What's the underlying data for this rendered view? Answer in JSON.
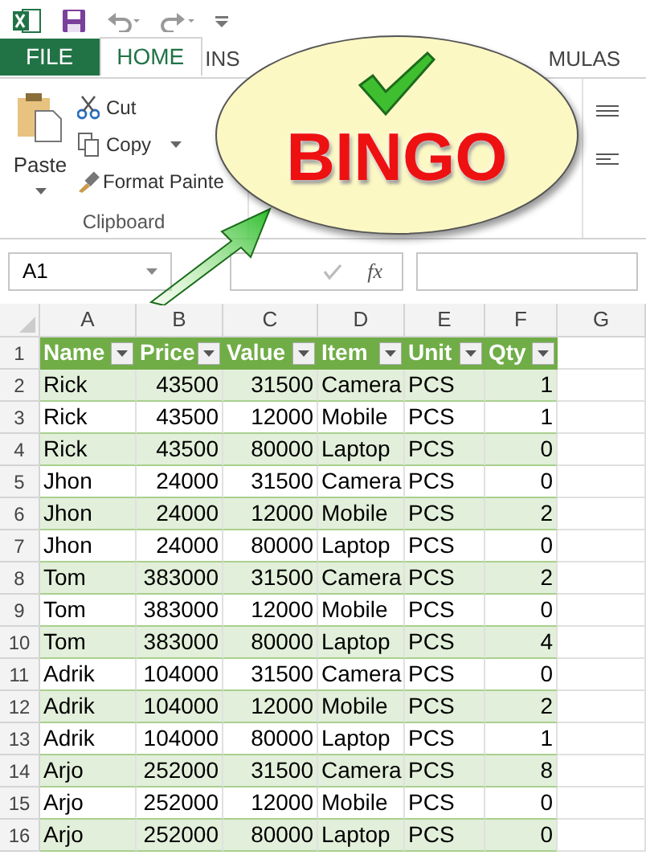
{
  "tabs": [
    {
      "label": "FILE",
      "kind": "file",
      "selected": false
    },
    {
      "label": "HOME",
      "kind": "tab",
      "selected": true
    },
    {
      "label": "INS",
      "kind": "tab",
      "selected": false
    },
    {
      "label": "MULAS",
      "kind": "tab",
      "selected": false
    }
  ],
  "clipboard": {
    "paste": "Paste",
    "cut": "Cut",
    "copy": "Copy",
    "format_painter": "Format Painte",
    "group_label": "Clipboard"
  },
  "callout": {
    "text": "BINGO"
  },
  "name_box": "A1",
  "fx": "fx",
  "columns": [
    "A",
    "B",
    "C",
    "D",
    "E",
    "F",
    "G"
  ],
  "table_header": [
    "Name",
    "Price",
    "Value",
    "Item",
    "Unit",
    "Qty"
  ],
  "rows": [
    [
      "Rick",
      "43500",
      "31500",
      "Camera",
      "PCS",
      "1"
    ],
    [
      "Rick",
      "43500",
      "12000",
      "Mobile",
      "PCS",
      "1"
    ],
    [
      "Rick",
      "43500",
      "80000",
      "Laptop",
      "PCS",
      "0"
    ],
    [
      "Jhon",
      "24000",
      "31500",
      "Camera",
      "PCS",
      "0"
    ],
    [
      "Jhon",
      "24000",
      "12000",
      "Mobile",
      "PCS",
      "2"
    ],
    [
      "Jhon",
      "24000",
      "80000",
      "Laptop",
      "PCS",
      "0"
    ],
    [
      "Tom",
      "383000",
      "31500",
      "Camera",
      "PCS",
      "2"
    ],
    [
      "Tom",
      "383000",
      "12000",
      "Mobile",
      "PCS",
      "0"
    ],
    [
      "Tom",
      "383000",
      "80000",
      "Laptop",
      "PCS",
      "4"
    ],
    [
      "Adrik",
      "104000",
      "31500",
      "Camera",
      "PCS",
      "0"
    ],
    [
      "Adrik",
      "104000",
      "12000",
      "Mobile",
      "PCS",
      "2"
    ],
    [
      "Adrik",
      "104000",
      "80000",
      "Laptop",
      "PCS",
      "1"
    ],
    [
      "Arjo",
      "252000",
      "31500",
      "Camera",
      "PCS",
      "8"
    ],
    [
      "Arjo",
      "252000",
      "12000",
      "Mobile",
      "PCS",
      "0"
    ],
    [
      "Arjo",
      "252000",
      "80000",
      "Laptop",
      "PCS",
      "0"
    ]
  ],
  "row_numbers": [
    "1",
    "2",
    "3",
    "4",
    "5",
    "6",
    "7",
    "8",
    "9",
    "10",
    "11",
    "12",
    "13",
    "14",
    "15",
    "16"
  ]
}
